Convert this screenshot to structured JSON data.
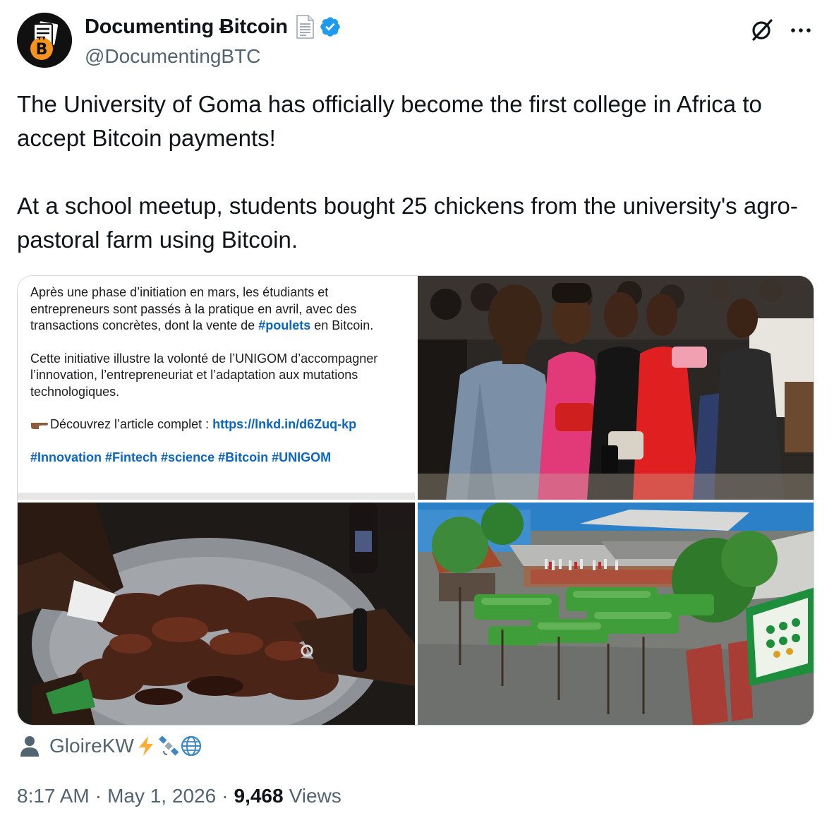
{
  "author": {
    "display_name": "Documenting Ƀitcoin",
    "handle": "@DocumentingBTC",
    "avatar_icon": "bitcoin-documents-logo",
    "badges": [
      "page-facing-up-emoji",
      "verified-badge-icon"
    ]
  },
  "header_actions": {
    "grok": "grok-icon",
    "more": "more-icon"
  },
  "tweet": {
    "paragraph_1": "The University of Goma has officially become the first college in Africa to accept Bitcoin payments!",
    "paragraph_2": "At a school meetup, students bought 25 chickens from the university's agro-pastoral farm using Bitcoin."
  },
  "media": {
    "screenshot_post": {
      "para1_before": "Après une phase d’initiation en mars, les étudiants et entrepreneurs sont passés à la pratique en avril, avec des transactions concrètes, dont la vente de ",
      "para1_hashtag": "#poulets",
      "para1_after": " en Bitcoin.",
      "para2": "Cette initiative illustre la volonté de l’UNIGOM d’accompagner l’innovation, l’entrepreneuriat et l’adaptation aux mutations technologiques.",
      "cta_text": "Découvrez l’article complet : ",
      "cta_link": "https://lnkd.in/d6Zuq-kp",
      "hashtags": "#Innovation #Fintech #science #Bitcoin #UNIGOM"
    },
    "photos": [
      "students-seated-photo",
      "roasted-chicken-platter-photo",
      "university-farm-photo"
    ]
  },
  "tagged_user": {
    "name": "GloireKW",
    "emojis": [
      "high-voltage-emoji",
      "satellite-emoji",
      "globe-emoji"
    ]
  },
  "meta": {
    "time": "8:17 AM",
    "date": "May 1, 2026",
    "views_count": "9,468",
    "views_label": "Views",
    "separator": "·"
  },
  "colors": {
    "text": "#0f1419",
    "secondary": "#536471",
    "link": "#0a66c2",
    "verified": "#1d9bf0",
    "border": "#cfd9de"
  }
}
